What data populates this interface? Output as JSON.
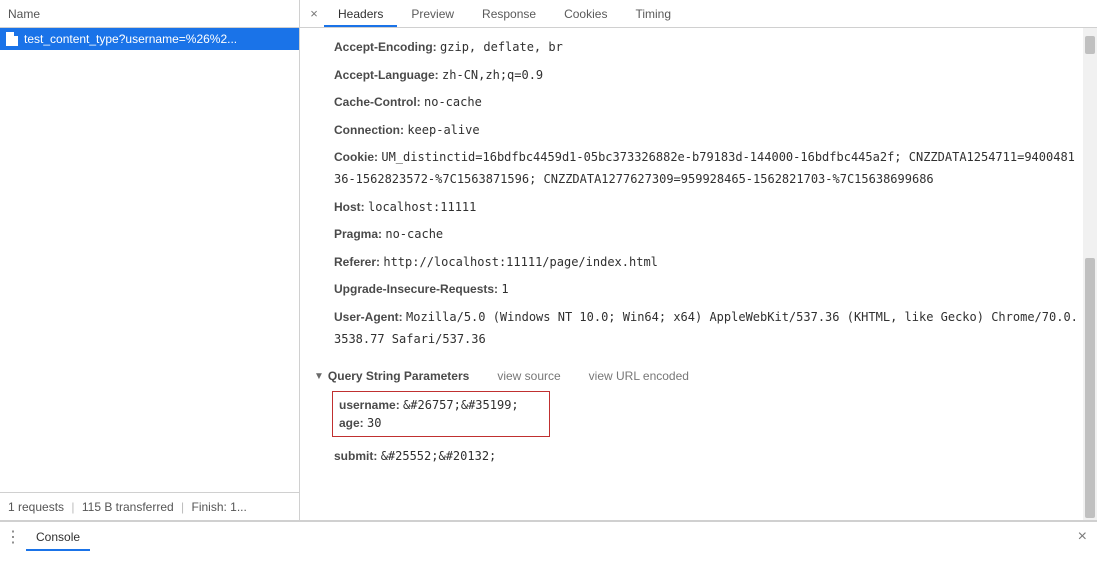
{
  "sidebar": {
    "header": "Name",
    "items": [
      {
        "label": "test_content_type?username=%26%2..."
      }
    ]
  },
  "status": {
    "requests": "1 requests",
    "transferred": "115 B transferred",
    "finish": "Finish: 1..."
  },
  "tabs": {
    "headers": "Headers",
    "preview": "Preview",
    "response": "Response",
    "cookies": "Cookies",
    "timing": "Timing"
  },
  "headers": [
    {
      "name": "Accept-Encoding:",
      "value": "gzip, deflate, br"
    },
    {
      "name": "Accept-Language:",
      "value": "zh-CN,zh;q=0.9"
    },
    {
      "name": "Cache-Control:",
      "value": "no-cache"
    },
    {
      "name": "Connection:",
      "value": "keep-alive"
    },
    {
      "name": "Cookie:",
      "value": "UM_distinctid=16bdfbc4459d1-05bc373326882e-b79183d-144000-16bdfbc445a2f; CNZZDATA1254711=940048136-1562823572-%7C1563871596; CNZZDATA1277627309=959928465-1562821703-%7C15638699686"
    },
    {
      "name": "Host:",
      "value": "localhost:11111"
    },
    {
      "name": "Pragma:",
      "value": "no-cache"
    },
    {
      "name": "Referer:",
      "value": "http://localhost:11111/page/index.html"
    },
    {
      "name": "Upgrade-Insecure-Requests:",
      "value": "1"
    },
    {
      "name": "User-Agent:",
      "value": "Mozilla/5.0 (Windows NT 10.0; Win64; x64) AppleWebKit/537.36 (KHTML, like Gecko) Chrome/70.0.3538.77 Safari/537.36"
    }
  ],
  "qsp": {
    "title": "Query String Parameters",
    "view_source": "view source",
    "view_encoded": "view URL encoded",
    "params": [
      {
        "name": "username:",
        "value": "&#26757;&#35199;"
      },
      {
        "name": "age:",
        "value": "30"
      },
      {
        "name": "submit:",
        "value": "&#25552;&#20132;"
      }
    ]
  },
  "console": {
    "label": "Console"
  }
}
